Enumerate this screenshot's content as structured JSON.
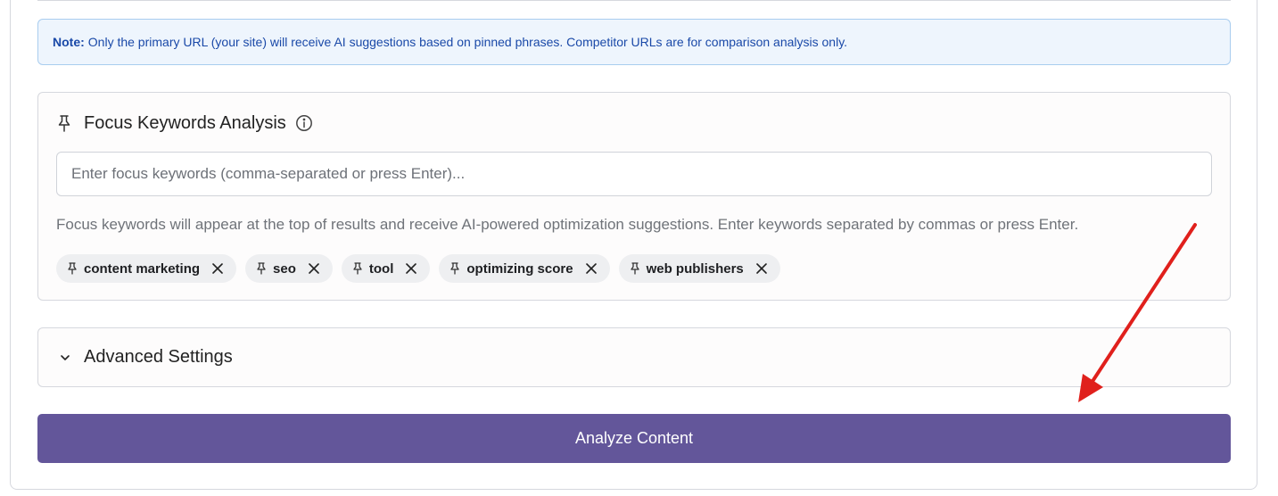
{
  "note": {
    "label": "Note:",
    "text": "Only the primary URL (your site) will receive AI suggestions based on pinned phrases. Competitor URLs are for comparison analysis only."
  },
  "focus_keywords": {
    "title": "Focus Keywords Analysis",
    "title_icon": "pin-icon",
    "info_icon": "info-circle-icon",
    "input_placeholder": "Enter focus keywords (comma-separated or press Enter)...",
    "input_value": "",
    "help_text": "Focus keywords will appear at the top of results and receive AI-powered optimization suggestions. Enter keywords separated by commas or press Enter.",
    "chips": [
      {
        "label": "content marketing"
      },
      {
        "label": "seo"
      },
      {
        "label": "tool"
      },
      {
        "label": "optimizing score"
      },
      {
        "label": "web publishers"
      }
    ]
  },
  "advanced_settings": {
    "label": "Advanced Settings",
    "icon": "chevron-down-icon"
  },
  "analyze_button": {
    "label": "Analyze Content"
  },
  "colors": {
    "primary_button": "#63569a",
    "note_background": "#eef5fd",
    "note_text": "#1a49a8",
    "annotation_arrow": "#e0201c"
  }
}
